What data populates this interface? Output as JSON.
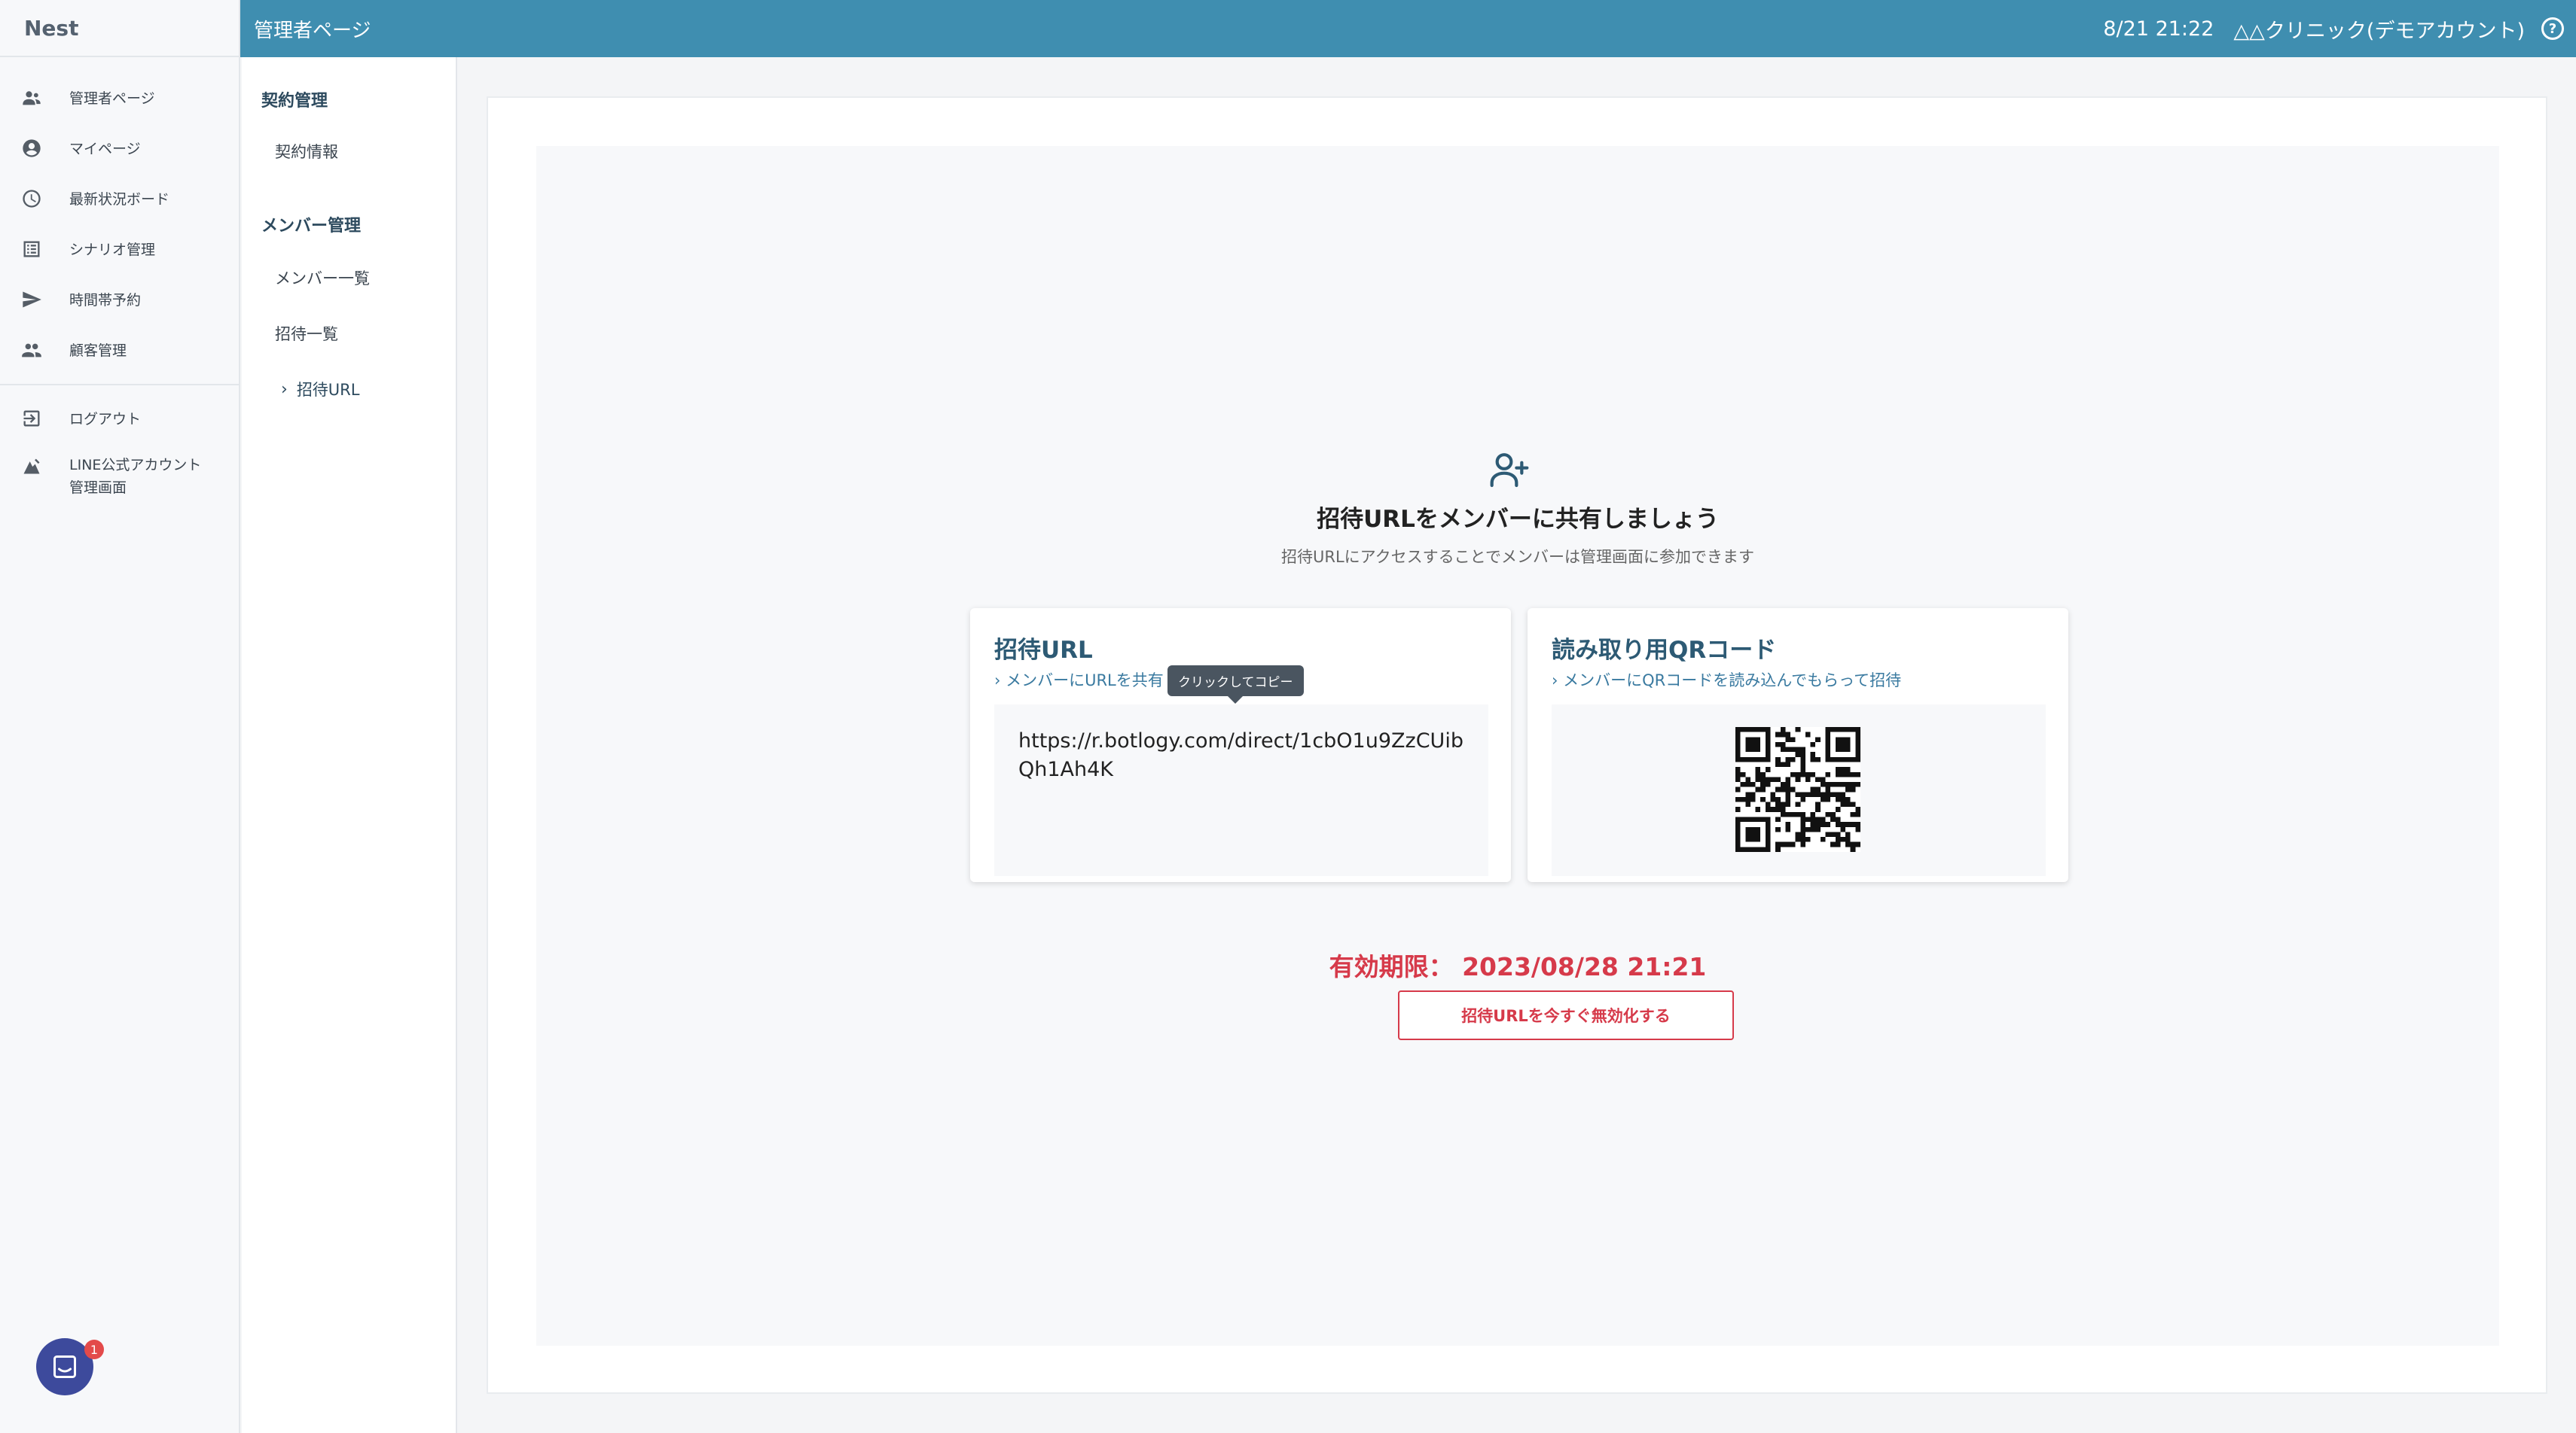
{
  "app": {
    "brand": "Nest"
  },
  "sidebar": {
    "items": [
      {
        "label": "管理者ページ",
        "icon": "admin-users-icon"
      },
      {
        "label": "マイページ",
        "icon": "account-circle-icon"
      },
      {
        "label": "最新状況ボード",
        "icon": "clock-icon"
      },
      {
        "label": "シナリオ管理",
        "icon": "list-icon"
      },
      {
        "label": "時間帯予約",
        "icon": "send-icon"
      },
      {
        "label": "顧客管理",
        "icon": "people-icon"
      }
    ],
    "bottom_items": [
      {
        "label": "ログアウト",
        "icon": "logout-icon"
      },
      {
        "label_line1": "LINE公式アカウント",
        "label_line2": "管理画面",
        "icon": "external-admin-icon"
      }
    ]
  },
  "header": {
    "title": "管理者ページ",
    "datetime": "8/21 21:22",
    "account": "△△クリニック(デモアカウント)",
    "help_icon": "help-circle-icon"
  },
  "subnav": {
    "group1_title": "契約管理",
    "group1_items": [
      "契約情報"
    ],
    "group2_title": "メンバー管理",
    "group2_items": [
      "メンバー一覧",
      "招待一覧",
      "招待URL"
    ]
  },
  "main": {
    "icon": "add-person-icon",
    "title": "招待URLをメンバーに共有しましょう",
    "subtitle": "招待URLにアクセスすることでメンバーは管理画面に参加できます",
    "url_card": {
      "title": "招待URL",
      "link": "› メンバーにURLを共有",
      "url": "https://r.botlogy.com/direct/1cbO1u9ZzCUibQh1Ah4K",
      "tooltip": "クリックしてコピー"
    },
    "qr_card": {
      "title": "読み取り用QRコード",
      "link": "› メンバーにQRコードを読み込んでもらって招待"
    },
    "expiry": "有効期限： 2023/08/28 21:21",
    "disable_button": "招待URLを今すぐ無効化する"
  },
  "chat": {
    "badge": "1"
  },
  "colors": {
    "header": "#3f8eb0",
    "accent_red": "#d63a4a",
    "title_blue": "#2d5a74"
  }
}
